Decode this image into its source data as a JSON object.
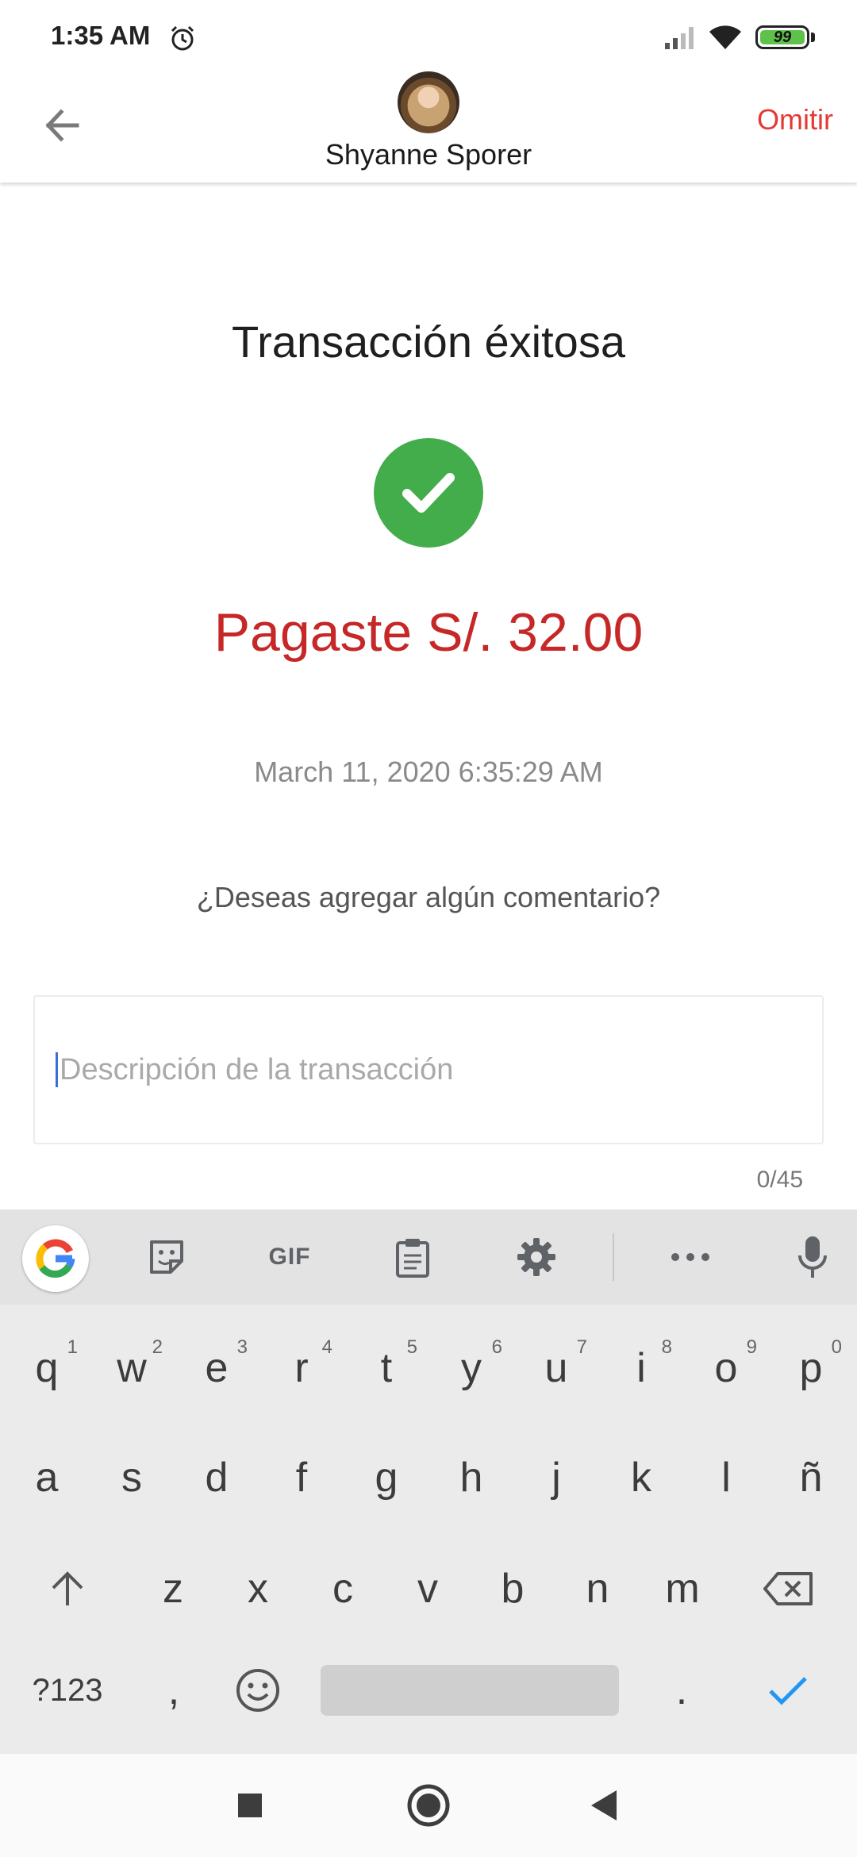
{
  "status_bar": {
    "time": "1:35 AM",
    "battery_level": "99",
    "icons": [
      "alarm-icon",
      "signal-icon",
      "wifi-icon",
      "battery-icon"
    ]
  },
  "app_bar": {
    "back_icon": "arrow-back-icon",
    "contact_name": "Shyanne Sporer",
    "skip_label": "Omitir"
  },
  "content": {
    "title": "Transacción éxitosa",
    "success_icon": "check-circle-icon",
    "amount_text": "Pagaste S/. 32.00",
    "datetime": "March 11, 2020 6:35:29 AM",
    "comment_question": "¿Deseas agregar algún comentario?",
    "description_placeholder": "Descripción de la transacción",
    "description_value": "",
    "char_counter": "0/45"
  },
  "keyboard": {
    "toolbar": [
      "google-icon",
      "sticker-icon",
      "GIF",
      "clipboard-icon",
      "gear-icon",
      "more-icon",
      "mic-icon"
    ],
    "gif_label": "GIF",
    "row1": [
      "q",
      "w",
      "e",
      "r",
      "t",
      "y",
      "u",
      "i",
      "o",
      "p"
    ],
    "row1_hints": [
      "1",
      "2",
      "3",
      "4",
      "5",
      "6",
      "7",
      "8",
      "9",
      "0"
    ],
    "row2": [
      "a",
      "s",
      "d",
      "f",
      "g",
      "h",
      "j",
      "k",
      "l",
      "ñ"
    ],
    "row3": [
      "z",
      "x",
      "c",
      "v",
      "b",
      "n",
      "m"
    ],
    "symbols_label": "?123",
    "comma": ",",
    "period": "."
  },
  "colors": {
    "accent_red": "#e53935",
    "amount_red": "#c62828",
    "success_green": "#43ad4b",
    "check_blue": "#2196f3"
  }
}
